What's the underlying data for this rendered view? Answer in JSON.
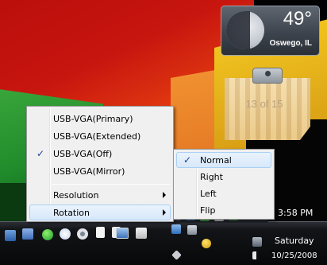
{
  "weather": {
    "temperature": "49°",
    "location": "Oswego, IL"
  },
  "slideshow": {
    "counter": "13 of 15"
  },
  "context_menu": {
    "items": [
      {
        "label": "USB-VGA(Primary)",
        "checked": false
      },
      {
        "label": "USB-VGA(Extended)",
        "checked": false
      },
      {
        "label": "USB-VGA(Off)",
        "checked": true
      },
      {
        "label": "USB-VGA(Mirror)",
        "checked": false
      }
    ],
    "submenus": [
      {
        "label": "Resolution",
        "has_submenu": true,
        "highlighted": false
      },
      {
        "label": "Rotation",
        "has_submenu": true,
        "highlighted": true
      }
    ],
    "check_glyph": "✓"
  },
  "rotation_menu": {
    "items": [
      {
        "label": "Normal",
        "checked": true,
        "highlighted": true
      },
      {
        "label": "Right",
        "checked": false,
        "highlighted": false
      },
      {
        "label": "Left",
        "checked": false,
        "highlighted": false
      },
      {
        "label": "Flip",
        "checked": false,
        "highlighted": false
      }
    ]
  },
  "taskbar": {
    "time": "3:58 PM",
    "day": "Saturday",
    "date": "10/25/2008",
    "quick_launch_icons": [
      "desktop-icon",
      "network-icon",
      "green-globe-icon",
      "media-icon",
      "disc-icon",
      "document-icon",
      "document-icon",
      "monitor-icon",
      "generic-app-icon"
    ],
    "tray_icons": [
      "usb-vga-icon",
      "network-tray-icon",
      "printer-icon",
      "app-tray-icon",
      "home-icon",
      "media-tray-icon",
      "monitor-tray-icon",
      "volume-icon",
      "security-icon",
      "language-icon"
    ]
  },
  "colors": {
    "menu_background": "#f0f0f0",
    "menu_highlight": "#d8e8fa",
    "check_mark": "#1d3f8f",
    "taskbar": "#070809"
  }
}
